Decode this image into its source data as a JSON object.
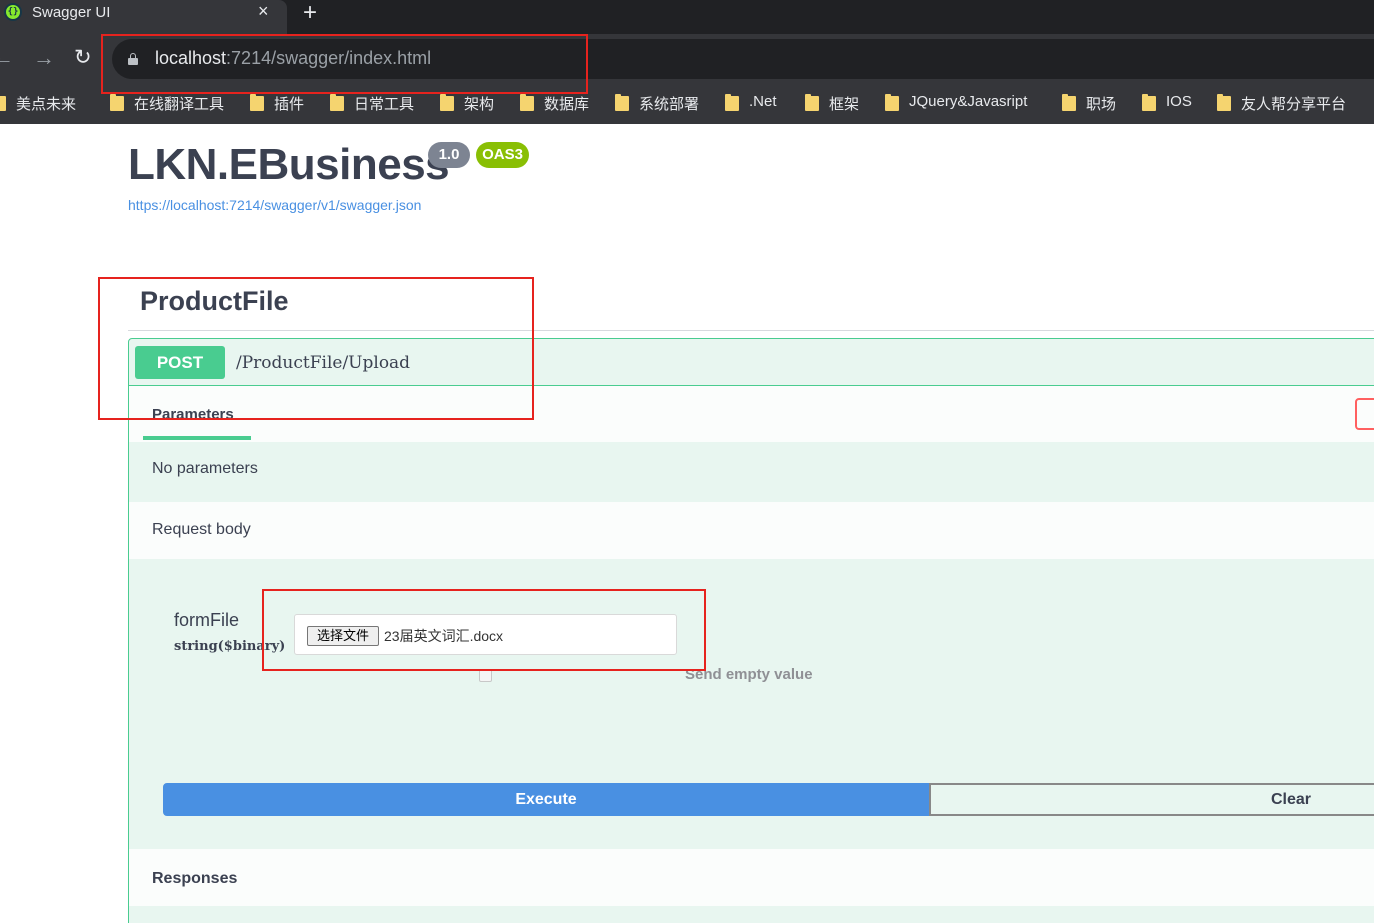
{
  "browser": {
    "tab": {
      "title": "Swagger UI",
      "favicon_label": "{}",
      "close_icon": "×"
    },
    "new_tab_icon": "+",
    "nav": {
      "back_icon": "←",
      "forward_icon": "→",
      "reload_icon": "↻"
    },
    "address": {
      "host": "localhost",
      "rest": ":7214/swagger/index.html"
    },
    "bookmarks": [
      "美点未来",
      "在线翻译工具",
      "插件",
      "日常工具",
      "架构",
      "数据库",
      "系统部署",
      ".Net",
      "框架",
      "JQuery&Javasript",
      "职场",
      "IOS",
      "友人帮分享平台"
    ]
  },
  "info": {
    "title": "LKN.EBusiness",
    "version": "1.0",
    "oas": "OAS3",
    "spec_url": "https://localhost:7214/swagger/v1/swagger.json"
  },
  "tag": {
    "name": "ProductFile"
  },
  "operation": {
    "method": "POST",
    "path": "/ProductFile/Upload",
    "parameters_tab": "Parameters",
    "no_parameters": "No parameters",
    "request_body_label": "Request body",
    "form_field": {
      "name": "formFile",
      "type": "string($binary)",
      "choose_button": "选择文件",
      "file_name": "23届英文词汇.docx",
      "send_empty_label": "Send empty value"
    },
    "execute_label": "Execute",
    "clear_label": "Clear",
    "responses_label": "Responses"
  },
  "colors": {
    "post": "#49cc90",
    "post_bg": "#e8f6f0",
    "execute": "#4990e2",
    "annotation": "#e6231e"
  }
}
